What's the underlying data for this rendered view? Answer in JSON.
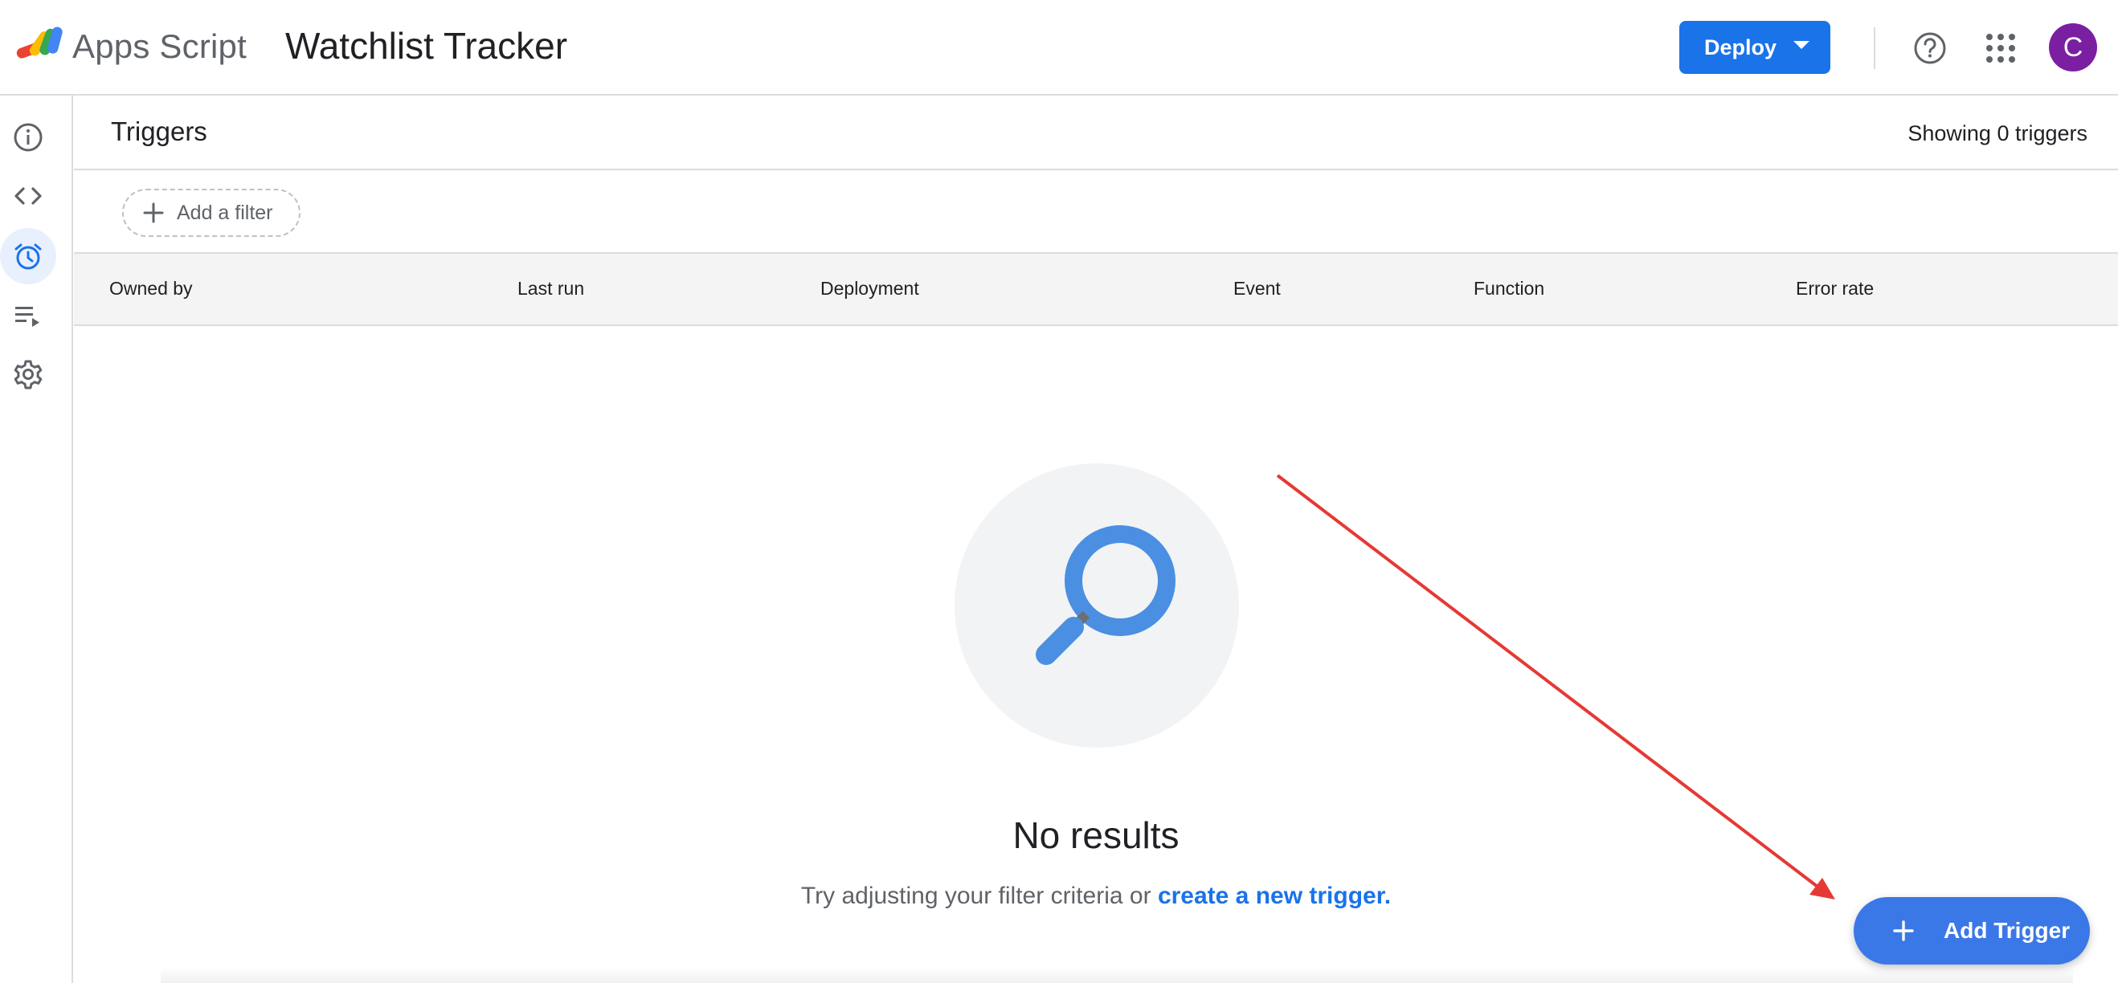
{
  "header": {
    "product_name": "Apps Script",
    "project_title": "Watchlist Tracker",
    "deploy_label": "Deploy",
    "avatar_letter": "C",
    "avatar_color": "#7b1fa2"
  },
  "rail": {
    "items": [
      {
        "icon": "info-icon",
        "active": false
      },
      {
        "icon": "code-icon",
        "active": false
      },
      {
        "icon": "alarm-clock-icon",
        "active": true
      },
      {
        "icon": "executions-icon",
        "active": false
      },
      {
        "icon": "gear-icon",
        "active": false
      }
    ]
  },
  "main": {
    "section_title": "Triggers",
    "count_text": "Showing 0 triggers",
    "filter_label": "Add a filter",
    "columns": [
      "Owned by",
      "Last run",
      "Deployment",
      "Event",
      "Function",
      "Error rate"
    ],
    "empty_title": "No results",
    "empty_sub_prefix": "Try adjusting your filter criteria or ",
    "empty_sub_link": "create a new trigger.",
    "fab_label": "Add Trigger"
  },
  "colors": {
    "accent": "#1a73e8",
    "fab": "#3b78e7",
    "annotation_arrow": "#e53935"
  }
}
